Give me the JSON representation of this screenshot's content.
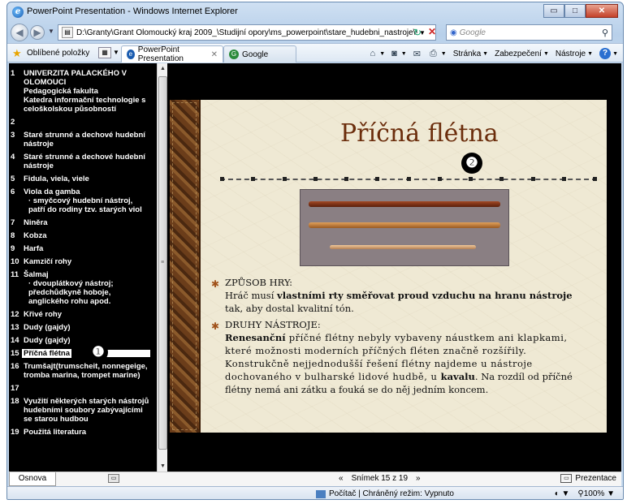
{
  "window": {
    "title": "PowerPoint Presentation - Windows Internet Explorer",
    "controls": {
      "minimize": "▭",
      "maximize": "□",
      "close": "✕"
    }
  },
  "address_bar": {
    "url": "D:\\Granty\\Grant Olomoucký kraj 2009_\\Studijní opory\\ms_powerpoint\\stare_hudebni_nastroje\\staré nástroj",
    "search_placeholder": "Google"
  },
  "favorites_bar": {
    "favorites_label": "Oblíbené položky",
    "tabs": [
      {
        "label": "PowerPoint Presentation",
        "active": true
      },
      {
        "label": "Google",
        "active": false
      }
    ],
    "commands": {
      "page": "Stránka",
      "security": "Zabezpečení",
      "tools": "Nástroje"
    }
  },
  "outline": {
    "items": [
      {
        "num": "1",
        "lines": [
          "UNIVERZITA PALACKÉHO V OLOMOUCI",
          "Pedagogická fakulta",
          "Katedra informační technologie s celoškolskou působností"
        ]
      },
      {
        "num": "2",
        "lines": [
          ""
        ]
      },
      {
        "num": "3",
        "lines": [
          "Staré strunné a dechové hudební  nástroje"
        ]
      },
      {
        "num": "4",
        "lines": [
          "Staré strunné a dechové hudební nástroje"
        ]
      },
      {
        "num": "5",
        "lines": [
          "Fidula, viela, viele"
        ]
      },
      {
        "num": "6",
        "lines": [
          "Viola da gamba",
          "· smyčcový hudební nástroj, patří do rodiny tzv. starých viol"
        ]
      },
      {
        "num": "7",
        "lines": [
          "Niněra"
        ]
      },
      {
        "num": "8",
        "lines": [
          "Kobza"
        ]
      },
      {
        "num": "9",
        "lines": [
          "Harfa"
        ]
      },
      {
        "num": "10",
        "lines": [
          "Kamzičí rohy"
        ]
      },
      {
        "num": "11",
        "lines": [
          "Šalmaj",
          "· dvouplátkový nástroj; předchůdkyně hoboje, anglického rohu apod."
        ]
      },
      {
        "num": "12",
        "lines": [
          "Křivé rohy"
        ]
      },
      {
        "num": "13",
        "lines": [
          "Dudy (gajdy)"
        ]
      },
      {
        "num": "14",
        "lines": [
          "Dudy (gajdy)"
        ]
      },
      {
        "num": "15",
        "lines": [
          "Příčná flétna"
        ],
        "selected": true
      },
      {
        "num": "16",
        "lines": [
          "Trumšajt(trumscheit, nonnegeige, tromba marina, trompet marine)"
        ]
      },
      {
        "num": "17",
        "lines": [
          ""
        ]
      },
      {
        "num": "18",
        "lines": [
          "Využití některých starých nástrojů hudebními soubory zabývajícími se starou hudbou"
        ]
      },
      {
        "num": "19",
        "lines": [
          "Použitá literatura"
        ]
      }
    ],
    "badge": "❶"
  },
  "slide": {
    "title": "Příčná flétna",
    "badge": "❷",
    "bullet1_head": "ZPŮSOB HRY:",
    "bullet1_a": "Hráč musí ",
    "bullet1_b": "vlastními rty směřovat proud vzduchu na hranu nástroje",
    "bullet1_c": " tak, aby dostal kvalitní tón.",
    "bullet2_head": "DRUHY NÁSTROJE:",
    "bullet2_a": "Renesanční",
    "bullet2_b": " příčné flétny nebyly vybaveny náustkem ani klapkami, které možnosti moderních příčných fléten značně rozšířily.",
    "bullet2_c": "Konstrukčně nejjednodušší řešení flétny najdeme u nástroje dochovaného v bulharské lidové hudbě, u ",
    "bullet2_d": "kavalu",
    "bullet2_e": ". Na rozdíl od příčné flétny nemá ani zátku a fouká se do něj jedním koncem."
  },
  "bottom": {
    "outline_tab": "Osnova",
    "slide_counter": "Snímek 15 z 19",
    "prev": "«",
    "next": "»",
    "presentation": "Prezentace"
  },
  "status": {
    "zone": "Počítač | Chráněný režim: Vypnuto",
    "zoom": "100%"
  }
}
